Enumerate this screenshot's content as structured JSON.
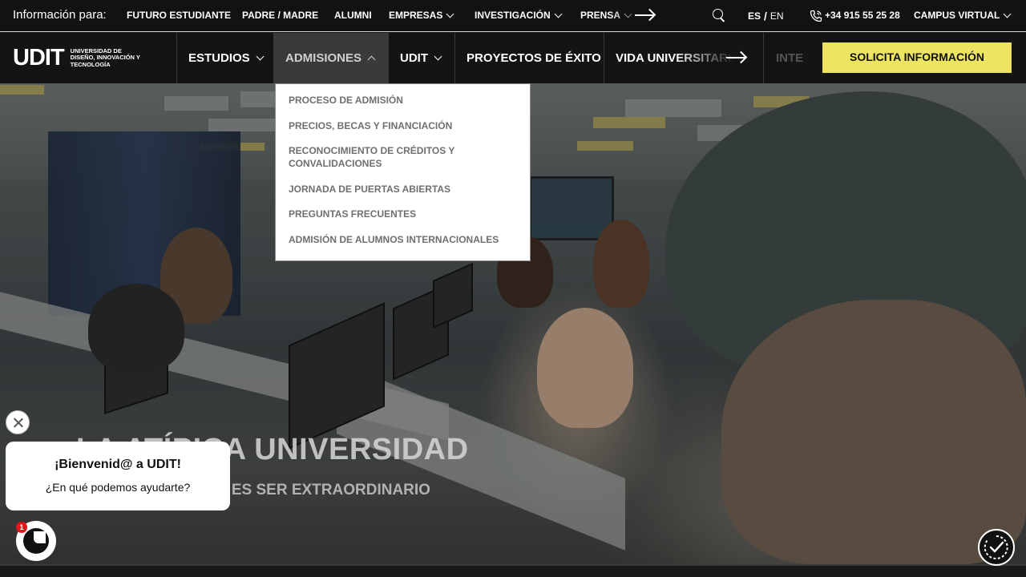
{
  "topbar": {
    "info_label": "Información para:",
    "links": [
      {
        "label": "FUTURO ESTUDIANTE"
      },
      {
        "label": "PADRE / MADRE"
      },
      {
        "label": "ALUMNI"
      },
      {
        "label": "EMPRESAS"
      },
      {
        "label": "INVESTIGACIÓN"
      },
      {
        "label": "PRENSA"
      }
    ],
    "lang_es": "ES",
    "lang_sep": "/",
    "lang_en": "EN",
    "phone": "+34 915 55 25 28",
    "campus": "CAMPUS VIRTUAL"
  },
  "logo": {
    "mark": "UDIT",
    "text": "UNIVERSIDAD DE DISEÑO, INNOVACIÓN Y TECNOLOGÍA"
  },
  "nav": {
    "items": [
      {
        "label": "ESTUDIOS"
      },
      {
        "label": "ADMISIONES"
      },
      {
        "label": "UDIT"
      },
      {
        "label": "PROYECTOS DE ÉXITO"
      },
      {
        "label": "VIDA UNIVERSITARIA"
      },
      {
        "label": "INTE"
      }
    ],
    "cta": "SOLICITA INFORMACIÓN"
  },
  "dropdown": {
    "items": [
      "PROCESO DE ADMISIÓN",
      "PRECIOS, BECAS Y FINANCIACIÓN",
      "RECONOCIMIENTO DE CRÉDITOS Y CONVALIDACIONES",
      "JORNADA DE PUERTAS ABIERTAS",
      "PREGUNTAS FRECUENTES",
      "ADMISIÓN DE ALUMNOS INTERNACIONALES"
    ]
  },
  "hero": {
    "title": "LA ATÍPICA UNIVERSIDAD",
    "subtitle": "DONDE LO NORMAL ES SER EXTRAORDINARIO"
  },
  "chat": {
    "title": "¡Bienvenid@ a UDIT!",
    "text": "¿En qué podemos ayudarte?",
    "badge": "1"
  },
  "colors": {
    "cta": "#ede461",
    "bar": "#121212",
    "badge": "#e0161b"
  }
}
